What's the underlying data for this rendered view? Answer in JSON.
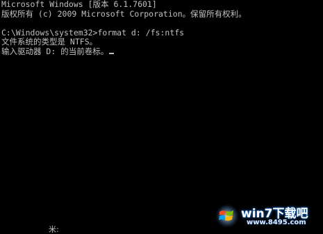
{
  "console": {
    "lines": [
      "Microsoft Windows [版本 6.1.7601]",
      "版权所有 (c) 2009 Microsoft Corporation。保留所有权利。",
      "",
      "C:\\Windows\\system32>format d: /fs:ntfs",
      "文件系统的类型是 NTFS。",
      "输入驱动器 D: 的当前卷标。"
    ],
    "bottom_fragment": "米:",
    "text_color": "#c0c0c0",
    "background_color": "#000000"
  },
  "watermark": {
    "title": "win7下载吧",
    "url": "www.8495.com",
    "icon": "windows-flag-icon"
  }
}
